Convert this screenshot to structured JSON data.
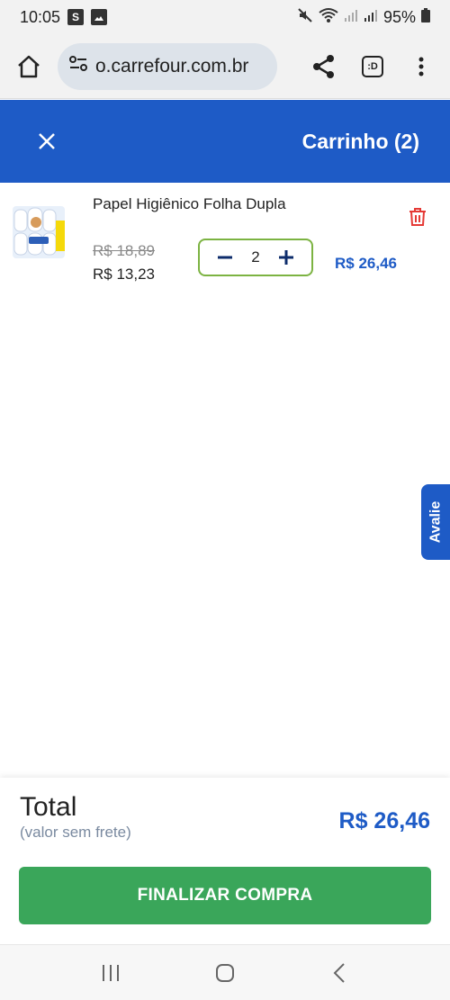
{
  "status_bar": {
    "time": "10:05",
    "notif_1": "S",
    "battery": "95%"
  },
  "browser": {
    "url": "o.carrefour.com.br",
    "tab_label": ":D"
  },
  "header": {
    "title": "Carrinho (2)"
  },
  "cart_item": {
    "name": "Papel Higiênico Folha Dupla",
    "old_price": "R$ 18,89",
    "price": "R$ 13,23",
    "quantity": "2",
    "line_total": "R$ 26,46"
  },
  "feedback_tab": {
    "label": "Avalie"
  },
  "summary": {
    "total_label": "Total",
    "total_note": "(valor sem frete)",
    "total_value": "R$ 26,46",
    "checkout_label": "FINALIZAR COMPRA"
  },
  "colors": {
    "brand_blue": "#1e5bc6",
    "checkout_green": "#3aa65a",
    "stepper_border": "#7cb342",
    "trash_red": "#e53935"
  }
}
